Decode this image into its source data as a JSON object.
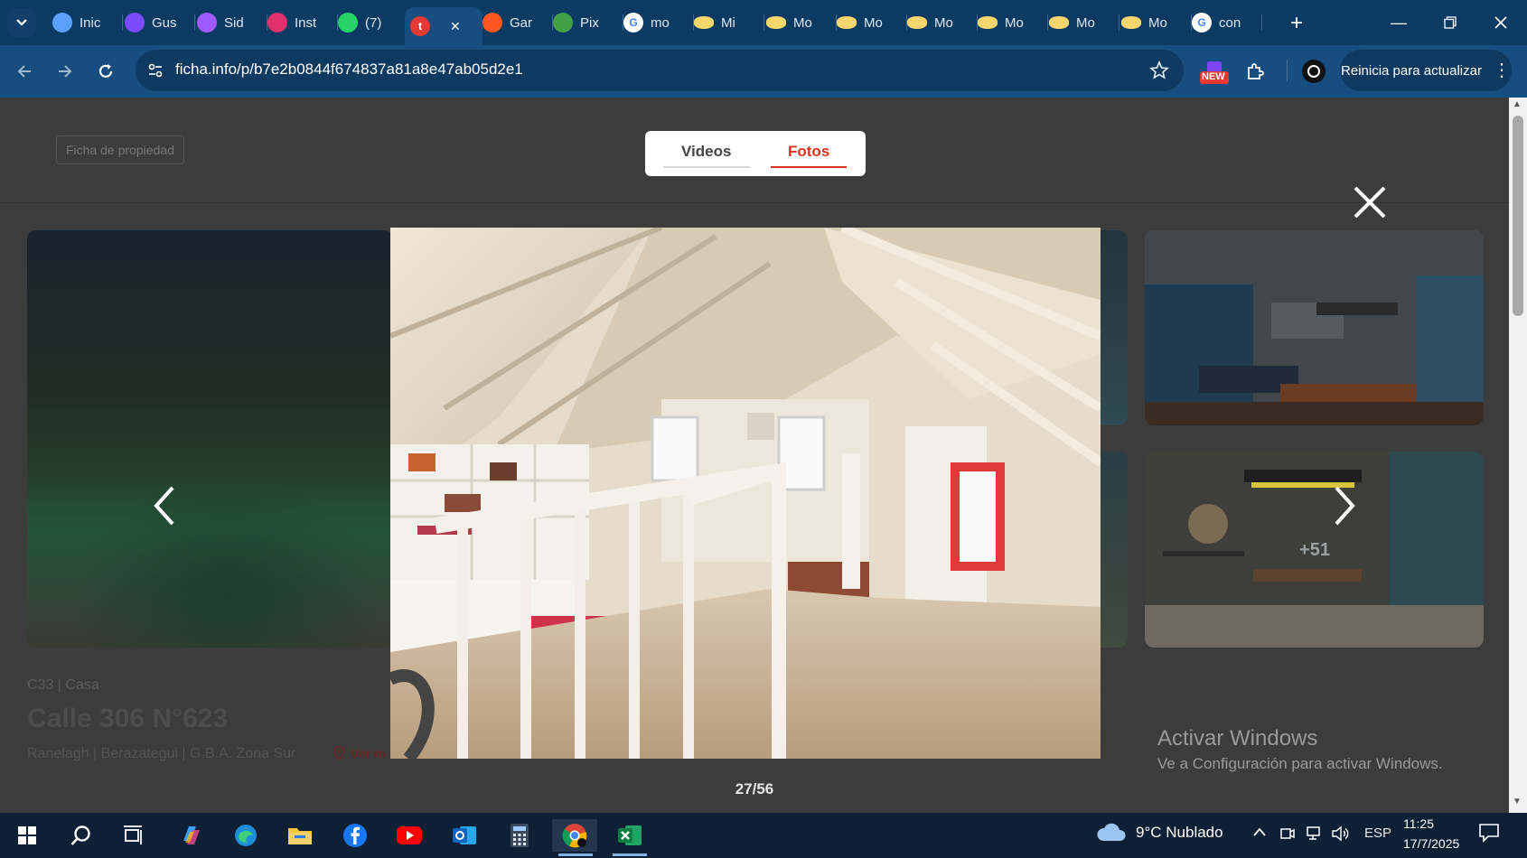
{
  "browser": {
    "tabs": [
      {
        "label": "Inic",
        "icon": "copilot-icon",
        "color": "#5aa0ff"
      },
      {
        "label": "Gus",
        "icon": "heart-icon",
        "color": "#7b4cff"
      },
      {
        "label": "Sid",
        "icon": "brain-icon",
        "color": "#a05bff"
      },
      {
        "label": "Inst",
        "icon": "instagram-icon",
        "color": "#e1306c"
      },
      {
        "label": "(7)",
        "icon": "whatsapp-icon",
        "color": "#25d366"
      },
      {
        "label": "t",
        "icon": "t-icon",
        "color": "#e53935",
        "active": true
      },
      {
        "label": "Gar",
        "icon": "garmin-icon",
        "color": "#ff5722"
      },
      {
        "label": "Pix",
        "icon": "sheets-icon",
        "color": "#43a047"
      },
      {
        "label": "mo",
        "icon": "google-icon",
        "color": "#ffffff"
      },
      {
        "label": "Mi",
        "icon": "eye-icon",
        "color": "#f5d76e"
      },
      {
        "label": "Mo",
        "icon": "eye-icon",
        "color": "#f5d76e"
      },
      {
        "label": "Mo",
        "icon": "eye-icon",
        "color": "#f5d76e"
      },
      {
        "label": "Mo",
        "icon": "eye-icon",
        "color": "#f5d76e"
      },
      {
        "label": "Mo",
        "icon": "eye-icon",
        "color": "#f5d76e"
      },
      {
        "label": "Mo",
        "icon": "eye-icon",
        "color": "#f5d76e"
      },
      {
        "label": "Mo",
        "icon": "eye-icon",
        "color": "#f5d76e"
      },
      {
        "label": "con",
        "icon": "google-icon",
        "color": "#ffffff"
      }
    ],
    "url": "ficha.info/p/b7e2b0844f674837a81a8e47ab05d2e1",
    "update_button": "Reinicia para actualizar",
    "new_badge": "NEW"
  },
  "page": {
    "badge": "Ficha de propiedad",
    "media_tabs": {
      "videos": "Videos",
      "fotos": "Fotos",
      "active": "fotos"
    },
    "photo_counter": "27/56",
    "more_photos": "+51",
    "property": {
      "type": "C33 | Casa",
      "title": "Calle 306 N°623",
      "location": "Ranelagh | Berazategui | G.B.A. Zona Sur",
      "map_link": "Ver m"
    },
    "windows_watermark": {
      "title": "Activar Windows",
      "subtitle": "Ve a Configuración para activar Windows."
    }
  },
  "taskbar": {
    "weather": "9°C  Nublado",
    "language": "ESP",
    "time": "11:25",
    "date": "17/7/2025"
  },
  "colors": {
    "accent_red": "#d9341e",
    "tab_strip": "#0b3a63",
    "toolbar": "#174d7f"
  }
}
